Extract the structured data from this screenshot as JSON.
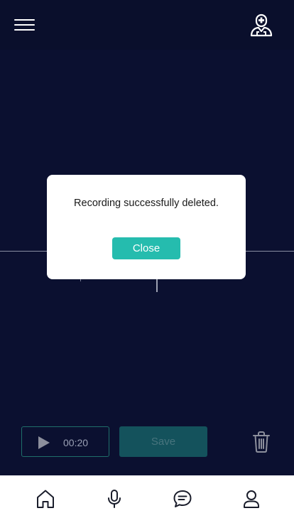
{
  "header": {
    "menu_icon": "hamburger-menu-icon",
    "profile_icon": "doctor-icon"
  },
  "dialog": {
    "message": "Recording successfully deleted.",
    "close_label": "Close"
  },
  "player": {
    "play_icon": "play-icon",
    "time": "00:20"
  },
  "actions": {
    "save_label": "Save",
    "delete_icon": "trash-icon"
  },
  "bottom_nav": {
    "items": [
      "home-icon",
      "microphone-icon",
      "chat-icon",
      "user-icon"
    ]
  },
  "colors": {
    "background": "#0b1030",
    "accent": "#25bcae",
    "save_disabled": "#14525c"
  }
}
